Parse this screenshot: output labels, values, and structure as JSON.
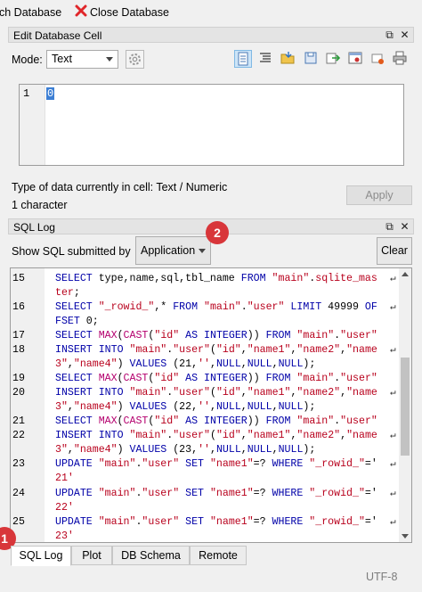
{
  "toolbar": {
    "item1": "ch Database",
    "item2": "Close Database"
  },
  "edit_cell": {
    "title": "Edit Database Cell",
    "mode_label": "Mode:",
    "mode_value": "Text",
    "line_number": "1",
    "cell_value": "0",
    "type_info": "Type of data currently in cell: Text / Numeric",
    "char_count": "1 character",
    "apply_label": "Apply"
  },
  "sql_log": {
    "title": "SQL Log",
    "show_label": "Show SQL submitted by",
    "source_value": "Application",
    "clear_label": "Clear",
    "rows": [
      {
        "n": "15",
        "code": [
          [
            "kw",
            "SELECT "
          ],
          [
            "plain",
            "type,name,sql,tbl_name "
          ],
          [
            "kw",
            "FROM "
          ],
          [
            "str",
            "\"main\""
          ],
          [
            "plain",
            "."
          ],
          [
            "str",
            "sqlite_mas"
          ]
        ],
        "wrap": true
      },
      {
        "n": "",
        "code": [
          [
            "str",
            "ter"
          ],
          [
            "plain",
            ";"
          ]
        ]
      },
      {
        "n": "16",
        "code": [
          [
            "kw",
            "SELECT "
          ],
          [
            "str",
            "\"_rowid_\""
          ],
          [
            "plain",
            ",* "
          ],
          [
            "kw",
            "FROM "
          ],
          [
            "str",
            "\"main\""
          ],
          [
            "plain",
            "."
          ],
          [
            "str",
            "\"user\""
          ],
          [
            "kw",
            " LIMIT "
          ],
          [
            "plain",
            "49999 "
          ],
          [
            "kw",
            "OF"
          ]
        ],
        "wrap": true
      },
      {
        "n": "",
        "code": [
          [
            "kw",
            "FSET "
          ],
          [
            "plain",
            "0;"
          ]
        ]
      },
      {
        "n": "17",
        "code": [
          [
            "kw",
            "SELECT "
          ],
          [
            "fn",
            "MAX"
          ],
          [
            "plain",
            "("
          ],
          [
            "fn",
            "CAST"
          ],
          [
            "plain",
            "("
          ],
          [
            "str",
            "\"id\""
          ],
          [
            "kw",
            " AS INTEGER"
          ],
          [
            "plain",
            ")) "
          ],
          [
            "kw",
            "FROM "
          ],
          [
            "str",
            "\"main\""
          ],
          [
            "plain",
            "."
          ],
          [
            "str",
            "\"user\""
          ]
        ]
      },
      {
        "n": "18",
        "code": [
          [
            "kw",
            "INSERT INTO "
          ],
          [
            "str",
            "\"main\""
          ],
          [
            "plain",
            "."
          ],
          [
            "str",
            "\"user\""
          ],
          [
            "plain",
            "("
          ],
          [
            "str",
            "\"id\""
          ],
          [
            "plain",
            ","
          ],
          [
            "str",
            "\"name1\""
          ],
          [
            "plain",
            ","
          ],
          [
            "str",
            "\"name2\""
          ],
          [
            "plain",
            ","
          ],
          [
            "str",
            "\"name"
          ]
        ],
        "wrap": true
      },
      {
        "n": "",
        "code": [
          [
            "str",
            "3\""
          ],
          [
            "plain",
            ","
          ],
          [
            "str",
            "\"name4\""
          ],
          [
            "plain",
            ") "
          ],
          [
            "kw",
            "VALUES "
          ],
          [
            "plain",
            "(21,"
          ],
          [
            "str",
            "''"
          ],
          [
            "plain",
            ","
          ],
          [
            "kw",
            "NULL"
          ],
          [
            "plain",
            ","
          ],
          [
            "kw",
            "NULL"
          ],
          [
            "plain",
            ","
          ],
          [
            "kw",
            "NULL"
          ],
          [
            "plain",
            ");"
          ]
        ]
      },
      {
        "n": "19",
        "code": [
          [
            "kw",
            "SELECT "
          ],
          [
            "fn",
            "MAX"
          ],
          [
            "plain",
            "("
          ],
          [
            "fn",
            "CAST"
          ],
          [
            "plain",
            "("
          ],
          [
            "str",
            "\"id\""
          ],
          [
            "kw",
            " AS INTEGER"
          ],
          [
            "plain",
            ")) "
          ],
          [
            "kw",
            "FROM "
          ],
          [
            "str",
            "\"main\""
          ],
          [
            "plain",
            "."
          ],
          [
            "str",
            "\"user\""
          ]
        ]
      },
      {
        "n": "20",
        "code": [
          [
            "kw",
            "INSERT INTO "
          ],
          [
            "str",
            "\"main\""
          ],
          [
            "plain",
            "."
          ],
          [
            "str",
            "\"user\""
          ],
          [
            "plain",
            "("
          ],
          [
            "str",
            "\"id\""
          ],
          [
            "plain",
            ","
          ],
          [
            "str",
            "\"name1\""
          ],
          [
            "plain",
            ","
          ],
          [
            "str",
            "\"name2\""
          ],
          [
            "plain",
            ","
          ],
          [
            "str",
            "\"name"
          ]
        ],
        "wrap": true
      },
      {
        "n": "",
        "code": [
          [
            "str",
            "3\""
          ],
          [
            "plain",
            ","
          ],
          [
            "str",
            "\"name4\""
          ],
          [
            "plain",
            ") "
          ],
          [
            "kw",
            "VALUES "
          ],
          [
            "plain",
            "(22,"
          ],
          [
            "str",
            "''"
          ],
          [
            "plain",
            ","
          ],
          [
            "kw",
            "NULL"
          ],
          [
            "plain",
            ","
          ],
          [
            "kw",
            "NULL"
          ],
          [
            "plain",
            ","
          ],
          [
            "kw",
            "NULL"
          ],
          [
            "plain",
            ");"
          ]
        ]
      },
      {
        "n": "21",
        "code": [
          [
            "kw",
            "SELECT "
          ],
          [
            "fn",
            "MAX"
          ],
          [
            "plain",
            "("
          ],
          [
            "fn",
            "CAST"
          ],
          [
            "plain",
            "("
          ],
          [
            "str",
            "\"id\""
          ],
          [
            "kw",
            " AS INTEGER"
          ],
          [
            "plain",
            ")) "
          ],
          [
            "kw",
            "FROM "
          ],
          [
            "str",
            "\"main\""
          ],
          [
            "plain",
            "."
          ],
          [
            "str",
            "\"user\""
          ]
        ]
      },
      {
        "n": "22",
        "code": [
          [
            "kw",
            "INSERT INTO "
          ],
          [
            "str",
            "\"main\""
          ],
          [
            "plain",
            "."
          ],
          [
            "str",
            "\"user\""
          ],
          [
            "plain",
            "("
          ],
          [
            "str",
            "\"id\""
          ],
          [
            "plain",
            ","
          ],
          [
            "str",
            "\"name1\""
          ],
          [
            "plain",
            ","
          ],
          [
            "str",
            "\"name2\""
          ],
          [
            "plain",
            ","
          ],
          [
            "str",
            "\"name"
          ]
        ],
        "wrap": true
      },
      {
        "n": "",
        "code": [
          [
            "str",
            "3\""
          ],
          [
            "plain",
            ","
          ],
          [
            "str",
            "\"name4\""
          ],
          [
            "plain",
            ") "
          ],
          [
            "kw",
            "VALUES "
          ],
          [
            "plain",
            "(23,"
          ],
          [
            "str",
            "''"
          ],
          [
            "plain",
            ","
          ],
          [
            "kw",
            "NULL"
          ],
          [
            "plain",
            ","
          ],
          [
            "kw",
            "NULL"
          ],
          [
            "plain",
            ","
          ],
          [
            "kw",
            "NULL"
          ],
          [
            "plain",
            ");"
          ]
        ]
      },
      {
        "n": "23",
        "code": [
          [
            "kw",
            "UPDATE "
          ],
          [
            "str",
            "\"main\""
          ],
          [
            "plain",
            "."
          ],
          [
            "str",
            "\"user\""
          ],
          [
            "kw",
            " SET "
          ],
          [
            "str",
            "\"name1\""
          ],
          [
            "plain",
            "=? "
          ],
          [
            "kw",
            "WHERE "
          ],
          [
            "str",
            "\"_rowid_\""
          ],
          [
            "plain",
            "='"
          ]
        ],
        "wrap": true
      },
      {
        "n": "",
        "code": [
          [
            "str",
            "21'"
          ]
        ]
      },
      {
        "n": "24",
        "code": [
          [
            "kw",
            "UPDATE "
          ],
          [
            "str",
            "\"main\""
          ],
          [
            "plain",
            "."
          ],
          [
            "str",
            "\"user\""
          ],
          [
            "kw",
            " SET "
          ],
          [
            "str",
            "\"name1\""
          ],
          [
            "plain",
            "=? "
          ],
          [
            "kw",
            "WHERE "
          ],
          [
            "str",
            "\"_rowid_\""
          ],
          [
            "plain",
            "='"
          ]
        ],
        "wrap": true
      },
      {
        "n": "",
        "code": [
          [
            "str",
            "22'"
          ]
        ]
      },
      {
        "n": "25",
        "code": [
          [
            "kw",
            "UPDATE "
          ],
          [
            "str",
            "\"main\""
          ],
          [
            "plain",
            "."
          ],
          [
            "str",
            "\"user\""
          ],
          [
            "kw",
            " SET "
          ],
          [
            "str",
            "\"name1\""
          ],
          [
            "plain",
            "=? "
          ],
          [
            "kw",
            "WHERE "
          ],
          [
            "str",
            "\"_rowid_\""
          ],
          [
            "plain",
            "='"
          ]
        ],
        "wrap": true
      },
      {
        "n": "",
        "code": [
          [
            "str",
            "23'"
          ]
        ]
      }
    ]
  },
  "annotations": {
    "badge1": "1",
    "badge2": "2"
  },
  "tabs": [
    "SQL Log",
    "Plot",
    "DB Schema",
    "Remote"
  ],
  "status": {
    "encoding": "UTF-8"
  },
  "colors": {
    "keyword": "#0000a8",
    "function": "#b4006e",
    "string": "#b8001c",
    "badge": "#d8363a",
    "selection": "#3d7fd4"
  }
}
